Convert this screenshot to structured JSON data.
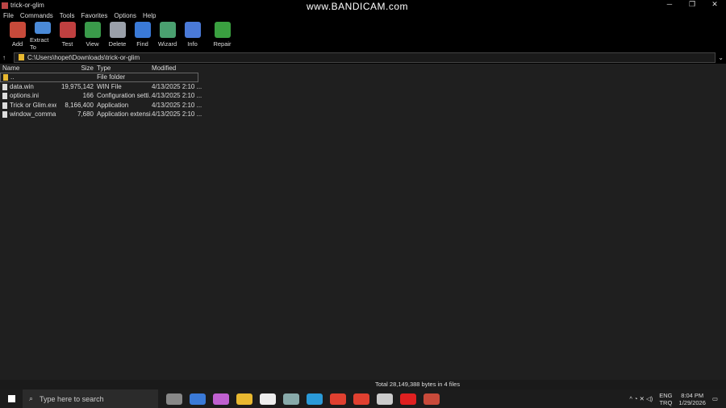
{
  "window": {
    "title": "trick-or-glim",
    "watermark": "www.BANDICAM.com"
  },
  "menu": [
    "File",
    "Commands",
    "Tools",
    "Favorites",
    "Options",
    "Help"
  ],
  "toolbar": [
    {
      "label": "Add",
      "color": "#c84a3a"
    },
    {
      "label": "Extract To",
      "color": "#4a8ad8"
    },
    {
      "label": "Test",
      "color": "#c04040"
    },
    {
      "label": "View",
      "color": "#3a9a4a"
    },
    {
      "label": "Delete",
      "color": "#9aa0aa"
    },
    {
      "label": "Find",
      "color": "#3a7ad8"
    },
    {
      "label": "Wizard",
      "color": "#4aa070"
    },
    {
      "label": "Info",
      "color": "#4a7ad8"
    },
    {
      "label": "Repair",
      "color": "#3aa040"
    }
  ],
  "address": "C:\\Users\\hopet\\Downloads\\trick-or-glim",
  "columns": [
    "Name",
    "Size",
    "Type",
    "Modified"
  ],
  "files": [
    {
      "name": "..",
      "size": "",
      "type": "File folder",
      "modified": ""
    },
    {
      "name": "data.win",
      "size": "19,975,142",
      "type": "WIN File",
      "modified": "4/13/2025 2:10 ..."
    },
    {
      "name": "options.ini",
      "size": "166",
      "type": "Configuration setti...",
      "modified": "4/13/2025 2:10 ..."
    },
    {
      "name": "Trick or Glim.exe",
      "size": "8,166,400",
      "type": "Application",
      "modified": "4/13/2025 2:10 ..."
    },
    {
      "name": "window_comma...",
      "size": "7,680",
      "type": "Application extensi...",
      "modified": "4/13/2025 2:10 ..."
    }
  ],
  "status": "Total 28,149,388 bytes in 4 files",
  "taskbar": {
    "search_placeholder": "Type here to search",
    "lang1": "ENG",
    "lang2": "TRQ",
    "time": "8:04 PM",
    "date": "1/29/2026"
  }
}
